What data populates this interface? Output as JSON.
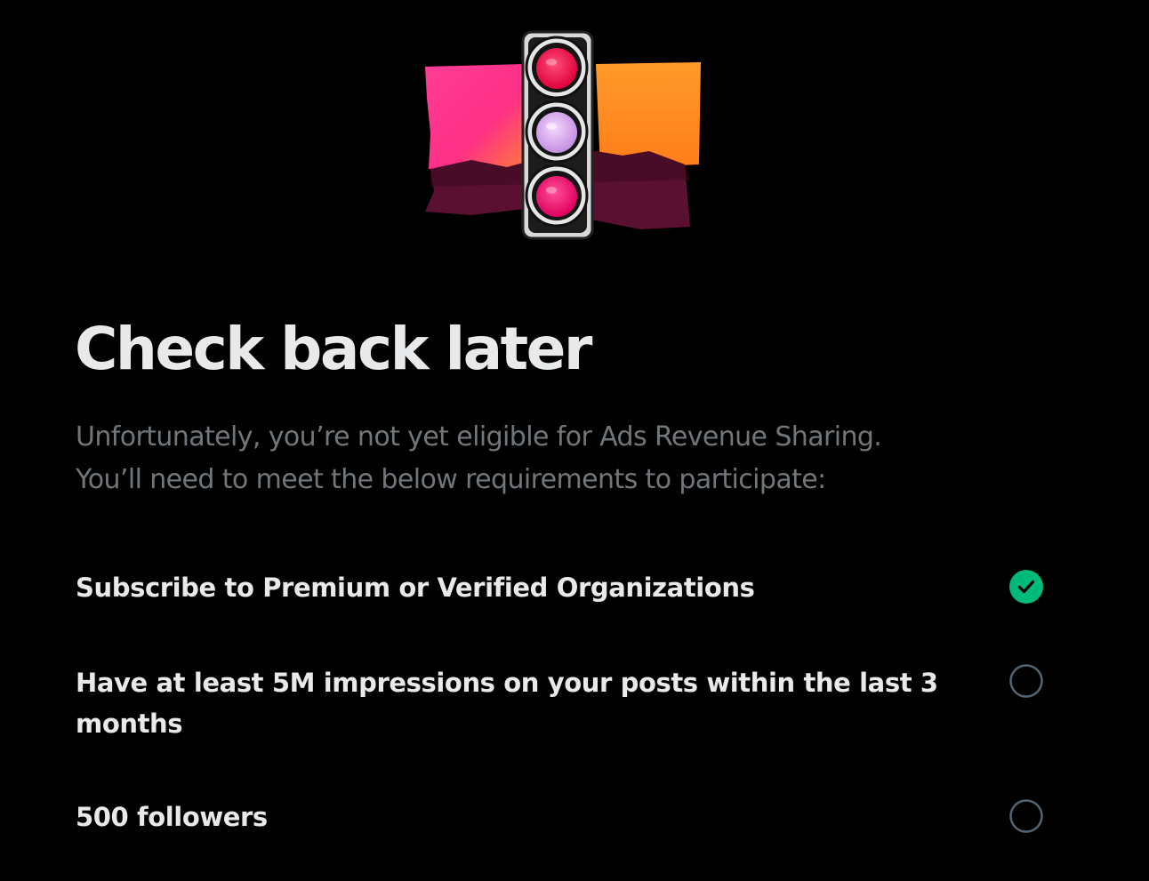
{
  "hero": {
    "illustration": "traffic-light-collage",
    "colors": {
      "pink_panel": "#ff2f86",
      "orange_panel": "#ff8a1f",
      "dark_panel": "#5a1030",
      "red_light": "#ff1f5a",
      "lilac_light": "#d9a8ee",
      "magenta_light": "#ff2a7e"
    }
  },
  "page": {
    "title": "Check back later",
    "subtitle_line1": "Unfortunately, you’re not yet eligible for Ads Revenue Sharing.",
    "subtitle_line2": "You’ll need to meet the below requirements to participate:"
  },
  "requirements": [
    {
      "label": "Subscribe to Premium or Verified Organizations",
      "met": true,
      "icon": "check-circle-icon"
    },
    {
      "label": "Have at least 5M impressions on your posts within the last 3 months",
      "met": false,
      "icon": "empty-circle-icon"
    },
    {
      "label": "500 followers",
      "met": false,
      "icon": "empty-circle-icon"
    }
  ],
  "colors": {
    "background": "#000000",
    "title_text": "#e7e9ea",
    "secondary_text": "#71767b",
    "success": "#00ba7c",
    "unchecked_border": "#536471"
  }
}
